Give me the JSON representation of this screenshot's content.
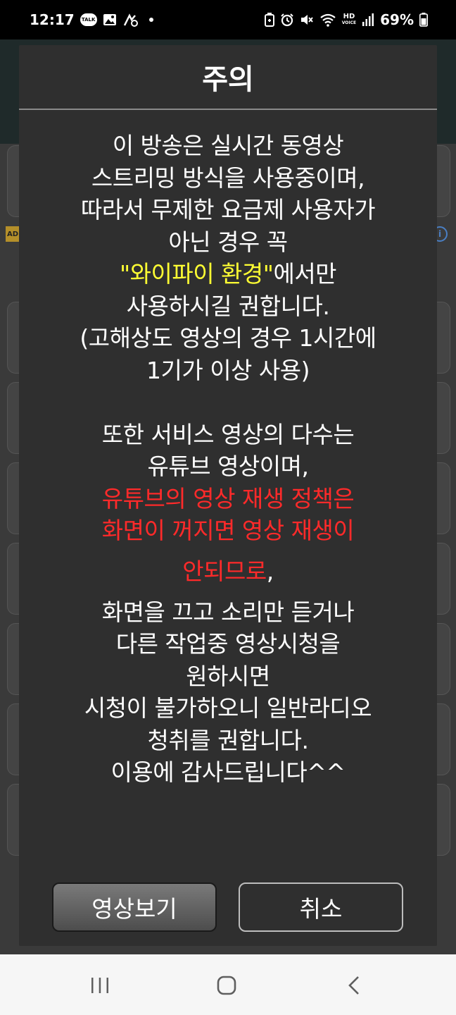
{
  "status_bar": {
    "time": "12:17",
    "battery": "69%",
    "notification_icons": [
      "kakaotalk-icon",
      "gallery-icon",
      "vibrate-icon",
      "dot-icon"
    ],
    "system_icons": [
      "battery-saver-icon",
      "alarm-icon",
      "mute-icon",
      "wifi-icon",
      "hd-voice-icon",
      "signal-icon",
      "battery-icon"
    ],
    "hd_label": "HD",
    "voice_label": "VOICE",
    "talk_label": "TALK"
  },
  "background": {
    "badge": "AD",
    "info": "i"
  },
  "dialog": {
    "title": "주의",
    "lines": {
      "l1": "이 방송은 실시간 동영상",
      "l2": "스트리밍 방식을 사용중이며,",
      "l3": "따라서 무제한 요금제 사용자가",
      "l4": "아닌 경우 꼭",
      "l5_highlight": "\"와이파이 환경\"",
      "l5_rest": "에서만",
      "l6": "사용하시길 권합니다.",
      "l7": "(고해상도 영상의 경우 1시간에",
      "l8": "1기가 이상 사용)",
      "l9": "또한 서비스 영상의 다수는",
      "l10": "유튜브 영상이며,",
      "l11_red": "유튜브의 영상 재생 정책은",
      "l12_red": "화면이 꺼지면 영상 재생이",
      "l13_red": "안되므로",
      "l13_rest": ",",
      "l14": "화면을 끄고 소리만 듣거나",
      "l15": "다른 작업중 영상시청을",
      "l16": "원하시면",
      "l17": "시청이 불가하오니 일반라디오",
      "l18": "청취를 권합니다.",
      "l19": "이용에 감사드립니다^^"
    },
    "buttons": {
      "watch": "영상보기",
      "cancel": "취소"
    },
    "colors": {
      "highlight_yellow": "#ffff33",
      "warning_red": "#ff2a2a"
    }
  },
  "nav_bar": {
    "buttons": [
      "recent-apps-icon",
      "home-icon",
      "back-icon"
    ]
  }
}
